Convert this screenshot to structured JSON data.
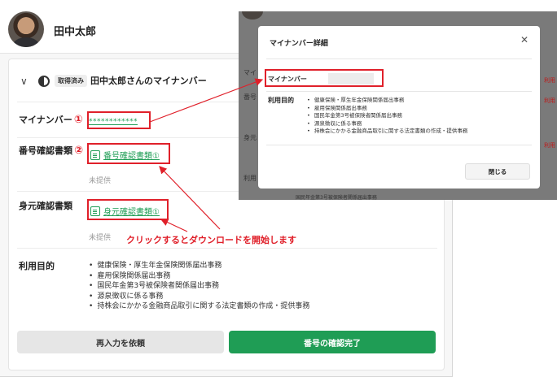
{
  "profile": {
    "name": "田中太郎"
  },
  "card": {
    "status_label": "取得済み",
    "title": "田中太郎さんのマイナンバー",
    "my_number_label": "マイナンバー",
    "marker_1": "①",
    "my_number_masked": "************",
    "number_doc_label": "番号確認書類",
    "marker_2": "②",
    "number_doc_link": "番号確認書類①",
    "not_provided_1": "未提供",
    "identity_doc_label": "身元確認書類",
    "identity_doc_link": "身元確認書類①",
    "not_provided_2": "未提供",
    "annotation": "クリックするとダウンロードを開始します",
    "purpose_label": "利用目的",
    "purposes": [
      "健康保険・厚生年金保険関係届出事務",
      "雇用保険関係届出事務",
      "国民年金第3号被保険者関係届出事務",
      "源泉徴収に係る事務",
      "持株会にかかる金融商品取引に関する法定書類の作成・提供事務"
    ],
    "reenter_button": "再入力を依頼",
    "confirm_button": "番号の確認完了"
  },
  "modal": {
    "title": "マイナンバー詳細",
    "my_number_label": "マイナンバー",
    "purpose_label": "利用目的",
    "purposes": [
      "健康保険・厚生年金保険関係届出事務",
      "雇用保険関係届出事務",
      "国民年金第3号被保険者関係届出事務",
      "源泉徴収に係る事務",
      "持株会にかかる金融商品取引に関する法定書類の作成・提供事務"
    ],
    "close_button": "閉じる"
  },
  "overlay_background": {
    "row_label_1": "番号",
    "row_label_2": "身元",
    "row_label_3": "利用",
    "partial_prefix": "マイ",
    "bottom_item": "国民年金第3号被保険者関係届出事務",
    "red_text": "利用"
  },
  "colors": {
    "accent_green": "#1f9d55",
    "annotation_red": "#e0202a"
  }
}
